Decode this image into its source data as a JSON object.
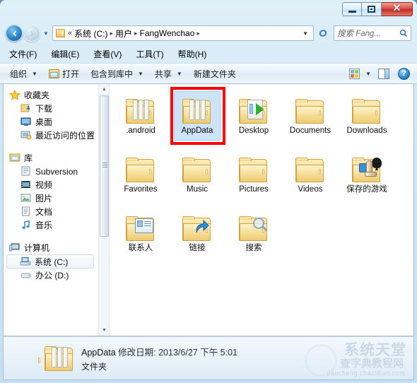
{
  "window": {
    "controls": {
      "minimize": "–",
      "maximize": "□",
      "close": "✕"
    }
  },
  "address": {
    "back_glyph": "◄",
    "forward_glyph": "►",
    "history_caret": "▼",
    "chevron": "«",
    "breadcrumbs": [
      "系统 (C:)",
      "用户",
      "FangWenchao"
    ],
    "separator": "▸",
    "dropdown_caret": "▼",
    "refresh_label": "↻",
    "search_placeholder": "搜索 Fang...",
    "search_icon": "search-icon"
  },
  "menu": {
    "items": [
      "文件(F)",
      "编辑(E)",
      "查看(V)",
      "工具(T)",
      "帮助(H)"
    ]
  },
  "toolbar": {
    "organize": "组织",
    "open": "打开",
    "include_in_library": "包含到库中",
    "share": "共享",
    "new_folder": "新建文件夹",
    "caret": "▼",
    "view_caret": "▼",
    "help": "?"
  },
  "sidebar": {
    "groups": [
      {
        "header": "收藏夹",
        "items": [
          "下载",
          "桌面",
          "最近访问的位置"
        ]
      },
      {
        "header": "库",
        "items": [
          "Subversion",
          "视频",
          "图片",
          "文档",
          "音乐"
        ]
      },
      {
        "header": "计算机",
        "items": [
          "系统 (C:)",
          "办公 (D:)"
        ]
      }
    ],
    "selected": "系统 (C:)",
    "scroll_up": "▲",
    "scroll_down": "▼"
  },
  "files": {
    "items": [
      {
        "name": ".android",
        "icon": "folder-documents-icon"
      },
      {
        "name": "AppData",
        "icon": "folder-documents-icon",
        "selected": true,
        "annotated": true
      },
      {
        "name": "Desktop",
        "icon": "folder-desktop-icon"
      },
      {
        "name": "Documents",
        "icon": "folder-icon"
      },
      {
        "name": "Downloads",
        "icon": "folder-icon"
      },
      {
        "name": "Favorites",
        "icon": "folder-icon"
      },
      {
        "name": "Music",
        "icon": "folder-icon"
      },
      {
        "name": "Pictures",
        "icon": "folder-icon"
      },
      {
        "name": "Videos",
        "icon": "folder-icon"
      },
      {
        "name": "保存的游戏",
        "icon": "folder-games-icon"
      },
      {
        "name": "联系人",
        "icon": "folder-contacts-icon"
      },
      {
        "name": "链接",
        "icon": "folder-links-icon"
      },
      {
        "name": "搜索",
        "icon": "folder-searches-icon"
      }
    ]
  },
  "status": {
    "name": "AppData",
    "modified_label": "修改日期:",
    "modified_value": "2013/6/27 下午 5:01",
    "type": "文件夹"
  },
  "watermark": {
    "big": "系统天堂",
    "mid": "查字典教程网",
    "url": "jiaocheng.chazidian.com"
  },
  "colors": {
    "selection": "#cde3f7",
    "annotation": "#ff0000",
    "accent": "#2a85c8"
  }
}
